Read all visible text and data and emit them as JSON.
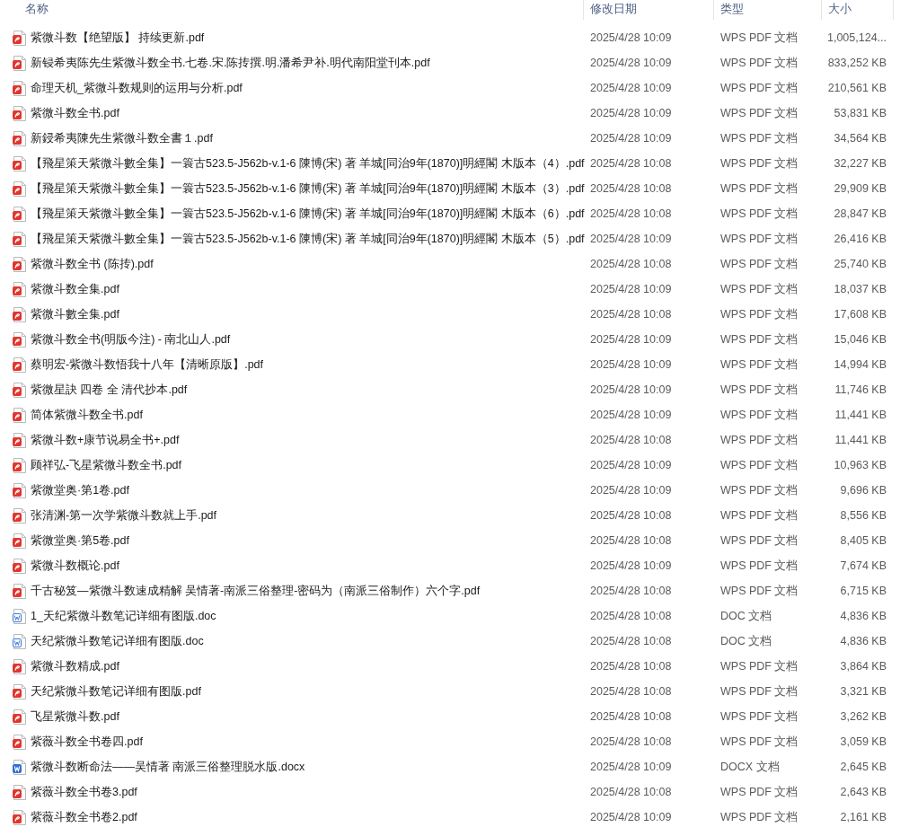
{
  "columns": [
    {
      "label": "名称"
    },
    {
      "label": "修改日期"
    },
    {
      "label": "类型"
    },
    {
      "label": "大小"
    }
  ],
  "files": [
    {
      "kind": "pdf",
      "name": "紫微斗数【绝望版】 持续更新.pdf",
      "modified": "2025/4/28 10:09",
      "type": "WPS PDF 文档",
      "size": "1,005,124..."
    },
    {
      "kind": "pdf",
      "name": "新锓希夷陈先生紫微斗数全书.七卷.宋.陈抟撰.明.潘希尹补.明代南阳堂刊本.pdf",
      "modified": "2025/4/28 10:09",
      "type": "WPS PDF 文档",
      "size": "833,252 KB"
    },
    {
      "kind": "pdf",
      "name": "命理天机_紫微斗数规则的运用与分析.pdf",
      "modified": "2025/4/28 10:09",
      "type": "WPS PDF 文档",
      "size": "210,561 KB"
    },
    {
      "kind": "pdf",
      "name": "紫微斗数全书.pdf",
      "modified": "2025/4/28 10:09",
      "type": "WPS PDF 文档",
      "size": "53,831 KB"
    },
    {
      "kind": "pdf",
      "name": "新鋟希夷陳先生紫微斗数全書１.pdf",
      "modified": "2025/4/28 10:09",
      "type": "WPS PDF 文档",
      "size": "34,564 KB"
    },
    {
      "kind": "pdf",
      "name": "【飛星策天紫微斗數全集】一簑古523.5-J562b-v.1-6 陳博(宋) 著 羊城[同治9年(1870)]明經閣 木版本（4）.pdf",
      "modified": "2025/4/28 10:08",
      "type": "WPS PDF 文档",
      "size": "32,227 KB"
    },
    {
      "kind": "pdf",
      "name": "【飛星策天紫微斗數全集】一簑古523.5-J562b-v.1-6 陳博(宋) 著 羊城[同治9年(1870)]明經閣 木版本（3）.pdf",
      "modified": "2025/4/28 10:08",
      "type": "WPS PDF 文档",
      "size": "29,909 KB"
    },
    {
      "kind": "pdf",
      "name": "【飛星策天紫微斗數全集】一簑古523.5-J562b-v.1-6 陳博(宋) 著 羊城[同治9年(1870)]明經閣 木版本（6）.pdf",
      "modified": "2025/4/28 10:08",
      "type": "WPS PDF 文档",
      "size": "28,847 KB"
    },
    {
      "kind": "pdf",
      "name": "【飛星策天紫微斗數全集】一簑古523.5-J562b-v.1-6 陳博(宋) 著 羊城[同治9年(1870)]明經閣 木版本（5）.pdf",
      "modified": "2025/4/28 10:09",
      "type": "WPS PDF 文档",
      "size": "26,416 KB"
    },
    {
      "kind": "pdf",
      "name": "紫微斗数全书 (陈抟).pdf",
      "modified": "2025/4/28 10:08",
      "type": "WPS PDF 文档",
      "size": "25,740 KB"
    },
    {
      "kind": "pdf",
      "name": "紫微斗数全集.pdf",
      "modified": "2025/4/28 10:09",
      "type": "WPS PDF 文档",
      "size": "18,037 KB"
    },
    {
      "kind": "pdf",
      "name": "紫微斗數全集.pdf",
      "modified": "2025/4/28 10:08",
      "type": "WPS PDF 文档",
      "size": "17,608 KB"
    },
    {
      "kind": "pdf",
      "name": "紫微斗数全书(明版今注) - 南北山人.pdf",
      "modified": "2025/4/28 10:09",
      "type": "WPS PDF 文档",
      "size": "15,046 KB"
    },
    {
      "kind": "pdf",
      "name": "蔡明宏-紫微斗数悟我十八年【清晰原版】.pdf",
      "modified": "2025/4/28 10:09",
      "type": "WPS PDF 文档",
      "size": "14,994 KB"
    },
    {
      "kind": "pdf",
      "name": "紫微星訣 四卷 全 清代抄本.pdf",
      "modified": "2025/4/28 10:09",
      "type": "WPS PDF 文档",
      "size": "11,746 KB"
    },
    {
      "kind": "pdf",
      "name": "简体紫微斗数全书.pdf",
      "modified": "2025/4/28 10:09",
      "type": "WPS PDF 文档",
      "size": "11,441 KB"
    },
    {
      "kind": "pdf",
      "name": "紫微斗数+康节说易全书+.pdf",
      "modified": "2025/4/28 10:08",
      "type": "WPS PDF 文档",
      "size": "11,441 KB"
    },
    {
      "kind": "pdf",
      "name": "顾祥弘-飞星紫微斗数全书.pdf",
      "modified": "2025/4/28 10:09",
      "type": "WPS PDF 文档",
      "size": "10,963 KB"
    },
    {
      "kind": "pdf",
      "name": "紫微堂奥·第1卷.pdf",
      "modified": "2025/4/28 10:09",
      "type": "WPS PDF 文档",
      "size": "9,696 KB"
    },
    {
      "kind": "pdf",
      "name": "张清渊-第一次学紫微斗数就上手.pdf",
      "modified": "2025/4/28 10:08",
      "type": "WPS PDF 文档",
      "size": "8,556 KB"
    },
    {
      "kind": "pdf",
      "name": "紫微堂奥·第5卷.pdf",
      "modified": "2025/4/28 10:08",
      "type": "WPS PDF 文档",
      "size": "8,405 KB"
    },
    {
      "kind": "pdf",
      "name": "紫微斗数概论.pdf",
      "modified": "2025/4/28 10:09",
      "type": "WPS PDF 文档",
      "size": "7,674 KB"
    },
    {
      "kind": "pdf",
      "name": "千古秘笈—紫微斗数速成精解 吴情著-南派三俗整理-密码为（南派三俗制作）六个字.pdf",
      "modified": "2025/4/28 10:08",
      "type": "WPS PDF 文档",
      "size": "6,715 KB"
    },
    {
      "kind": "doc",
      "name": "1_天纪紫微斗数笔记详细有图版.doc",
      "modified": "2025/4/28 10:08",
      "type": "DOC 文档",
      "size": "4,836 KB"
    },
    {
      "kind": "doc",
      "name": "天纪紫微斗数笔记详细有图版.doc",
      "modified": "2025/4/28 10:08",
      "type": "DOC 文档",
      "size": "4,836 KB"
    },
    {
      "kind": "pdf",
      "name": "紫微斗数精成.pdf",
      "modified": "2025/4/28 10:08",
      "type": "WPS PDF 文档",
      "size": "3,864 KB"
    },
    {
      "kind": "pdf",
      "name": "天纪紫微斗数笔记详细有图版.pdf",
      "modified": "2025/4/28 10:08",
      "type": "WPS PDF 文档",
      "size": "3,321 KB"
    },
    {
      "kind": "pdf",
      "name": "飞星紫微斗数.pdf",
      "modified": "2025/4/28 10:08",
      "type": "WPS PDF 文档",
      "size": "3,262 KB"
    },
    {
      "kind": "pdf",
      "name": "紫薇斗数全书卷四.pdf",
      "modified": "2025/4/28 10:08",
      "type": "WPS PDF 文档",
      "size": "3,059 KB"
    },
    {
      "kind": "docx",
      "name": "紫微斗数断命法——吴情著 南派三俗整理脱水版.docx",
      "modified": "2025/4/28 10:09",
      "type": "DOCX 文档",
      "size": "2,645 KB"
    },
    {
      "kind": "pdf",
      "name": "紫薇斗数全书卷3.pdf",
      "modified": "2025/4/28 10:08",
      "type": "WPS PDF 文档",
      "size": "2,643 KB"
    },
    {
      "kind": "pdf",
      "name": "紫薇斗数全书卷2.pdf",
      "modified": "2025/4/28 10:09",
      "type": "WPS PDF 文档",
      "size": "2,161 KB"
    }
  ]
}
